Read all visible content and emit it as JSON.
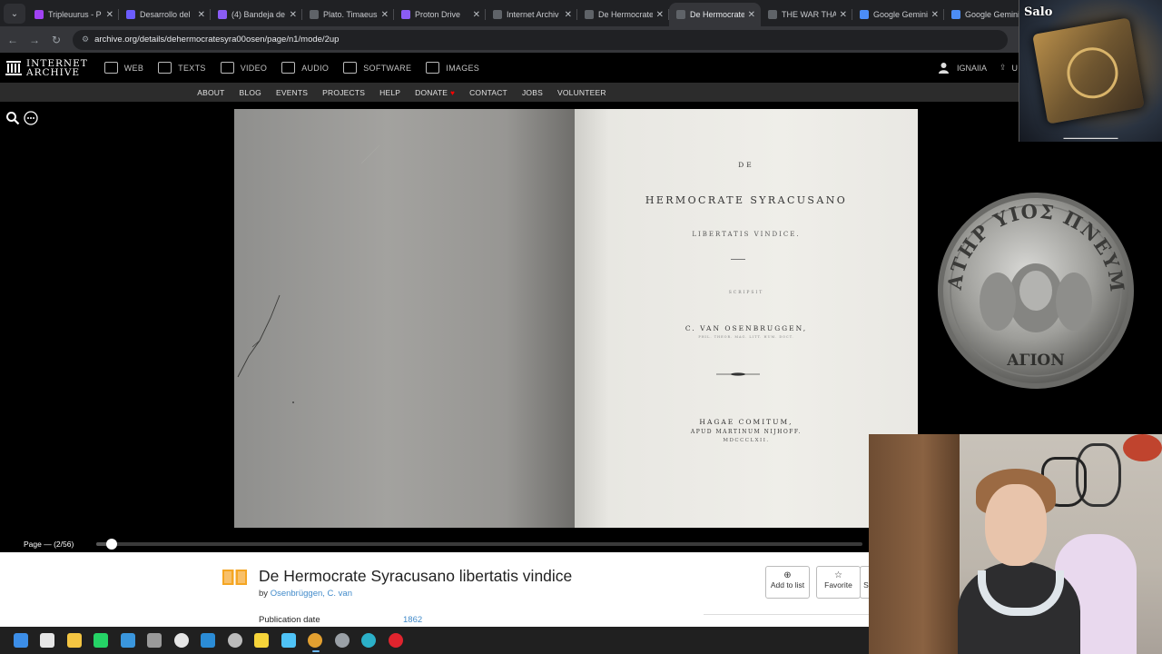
{
  "browser": {
    "tabs": [
      {
        "label": "Tripleuurus - P",
        "fav_color": "#a142f4",
        "active": false
      },
      {
        "label": "Desarrollo del",
        "fav_color": "#6b5cff",
        "active": false
      },
      {
        "label": "(4) Bandeja de",
        "fav_color": "#8b5cf6",
        "active": false
      },
      {
        "label": "Plato. Timaeus",
        "fav_color": "#5f6368",
        "active": false
      },
      {
        "label": "Proton Drive",
        "fav_color": "#8b5cf6",
        "active": false
      },
      {
        "label": "Internet Archiv",
        "fav_color": "#5f6368",
        "active": false
      },
      {
        "label": "De Hermocrate",
        "fav_color": "#5f6368",
        "active": false
      },
      {
        "label": "De Hermocrate",
        "fav_color": "#5f6368",
        "active": true
      },
      {
        "label": "THE WAR THA",
        "fav_color": "#5f6368",
        "active": false
      },
      {
        "label": "Google Gemini",
        "fav_color": "#4c8df6",
        "active": false
      },
      {
        "label": "Google Gemini",
        "fav_color": "#4c8df6",
        "active": false
      }
    ],
    "url": "archive.org/details/dehermocratesyra00osen/page/n1/mode/2up"
  },
  "ia": {
    "logo_line1": "INTERNET",
    "logo_line2": "ARCHIVE",
    "media": [
      "WEB",
      "TEXTS",
      "VIDEO",
      "AUDIO",
      "SOFTWARE",
      "IMAGES"
    ],
    "user_name": "IGNAIIA",
    "user_extra": "U",
    "sub_nav": [
      "ABOUT",
      "BLOG",
      "EVENTS",
      "PROJECTS",
      "HELP",
      "DONATE",
      "CONTACT",
      "JOBS",
      "VOLUNTEER"
    ],
    "donate_mark": "♥"
  },
  "book": {
    "page_label": "Page — (2/56)",
    "progress": 0.02,
    "title_page": {
      "de": "DE",
      "title": "HERMOCRATE SYRACUSANO",
      "subtitle": "LIBERTATIS VINDICE.",
      "scripsit": "SCRIPSIT",
      "author": "C. VAN OSENBRUGGEN,",
      "author_sub": "PHIL. THEOR. MAG. LITT. HUM. DOCT.",
      "publisher1": "HAGAE COMITUM,",
      "publisher2": "APUD MARTINUM NIJHOFF.",
      "publisher3": "MDCCCLXII."
    }
  },
  "item": {
    "title": "De Hermocrate Syracusano libertatis vindice",
    "by_prefix": "by",
    "author": "Osenbrüggen, C. van",
    "pub_key": "Publication date",
    "pub_value": "1862",
    "add_to_list": "Add to list",
    "favorite": "Favorite",
    "share_partial": "S"
  },
  "overlay": {
    "streamer_tag": "Salo",
    "coin_text": "ΠΑΤΗΡ ΥΙΟΣ ΠΝΕΥΜΑ",
    "coin_bottom": "ΑΓΙΟΝ"
  },
  "taskbar": {
    "apps": [
      {
        "name": "windows-start-icon",
        "color": "#3c8ee8"
      },
      {
        "name": "search-icon",
        "color": "#e6e6e6"
      },
      {
        "name": "file-explorer-icon",
        "color": "#f4c542"
      },
      {
        "name": "whatsapp-icon",
        "color": "#25d366"
      },
      {
        "name": "store-icon",
        "color": "#3a96dd"
      },
      {
        "name": "app-icon",
        "color": "#9a9a9a"
      },
      {
        "name": "chatgpt-icon",
        "color": "#e6e6e6"
      },
      {
        "name": "vscode-icon",
        "color": "#2b8cd6"
      },
      {
        "name": "obs-icon",
        "color": "#bbbbbb"
      },
      {
        "name": "sticky-notes-icon",
        "color": "#f6d43a"
      },
      {
        "name": "notepad-icon",
        "color": "#4fc3f7"
      },
      {
        "name": "chrome-icon",
        "color": "#e3a030"
      },
      {
        "name": "settings-icon",
        "color": "#9aa0a6"
      },
      {
        "name": "edge-icon",
        "color": "#2bb0c8"
      },
      {
        "name": "opera-icon",
        "color": "#e0242e"
      }
    ]
  }
}
